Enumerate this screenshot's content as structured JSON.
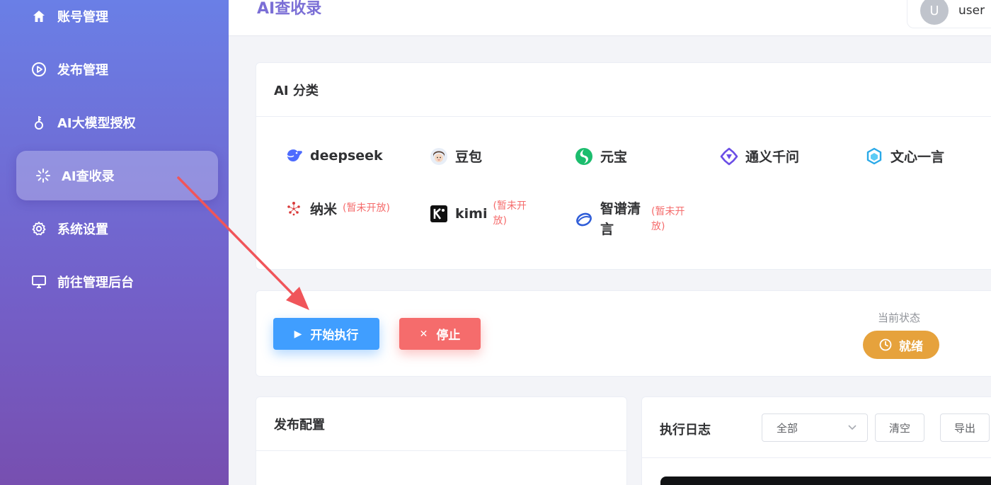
{
  "sidebar": {
    "items": [
      {
        "label": "账号管理",
        "icon": "home-icon"
      },
      {
        "label": "发布管理",
        "icon": "play-circle-icon"
      },
      {
        "label": "AI大模型授权",
        "icon": "key-icon"
      },
      {
        "label": "AI查收录",
        "icon": "loading-icon",
        "active": true
      },
      {
        "label": "系统设置",
        "icon": "gear-icon"
      },
      {
        "label": "前往管理后台",
        "icon": "monitor-icon"
      }
    ]
  },
  "header": {
    "title": "AI查收录",
    "user": {
      "avatar_letter": "U",
      "name": "user"
    }
  },
  "ai_category": {
    "title": "AI 分类",
    "items": [
      {
        "name": "deepseek",
        "logo": "deepseek-logo-icon"
      },
      {
        "name": "豆包",
        "logo": "doubao-logo-icon"
      },
      {
        "name": "元宝",
        "logo": "yuanbao-logo-icon"
      },
      {
        "name": "通义千问",
        "logo": "tongyi-logo-icon"
      },
      {
        "name": "文心一言",
        "logo": "wenxin-logo-icon"
      },
      {
        "name": "纳米",
        "logo": "nami-logo-icon",
        "tag": "(暂未开放)"
      },
      {
        "name": "kimi",
        "logo": "kimi-logo-icon",
        "tag": "(暂未开放)"
      },
      {
        "name": "智谱清言",
        "logo": "zhipu-logo-icon",
        "tag": "(暂未开放)"
      }
    ]
  },
  "controls": {
    "start_label": "开始执行",
    "stop_label": "停止",
    "status_label": "当前状态",
    "status_value": "就绪"
  },
  "publish_config": {
    "title": "发布配置"
  },
  "log": {
    "title": "执行日志",
    "filter_value": "全部",
    "clear_label": "清空",
    "export_label": "导出"
  },
  "colors": {
    "primary": "#409eff",
    "danger": "#f56c6c",
    "warning": "#e6a23c",
    "sidebar_top": "#6a7fe6",
    "sidebar_bottom": "#774fb0",
    "annotation_arrow": "#f0555a"
  }
}
